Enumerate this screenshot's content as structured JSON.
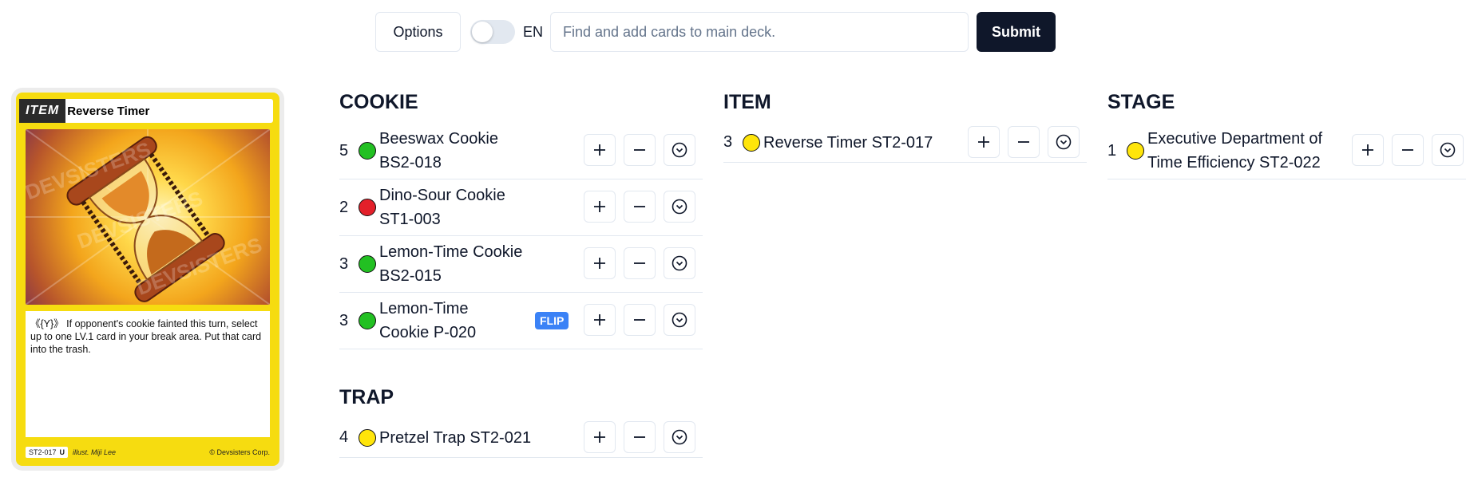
{
  "toolbar": {
    "options_label": "Options",
    "lang_label": "EN",
    "search_placeholder": "Find and add cards to main deck.",
    "search_value": "",
    "submit_label": "Submit"
  },
  "preview": {
    "type": "ITEM",
    "name": "Reverse Timer",
    "text": "《{Y}》 If opponent's cookie fainted this turn, select up to one LV.1 card in your break area. Put that card into the trash.",
    "set_code": "ST2-017",
    "rarity": "U",
    "illustrator": "illust. Miji Lee",
    "copyright": "© Devsisters Corp.",
    "watermark": "DEVSISTERS"
  },
  "sections": {
    "cookie": {
      "title": "COOKIE",
      "rows": [
        {
          "qty": "5",
          "color": "green",
          "line1": "Beeswax Cookie",
          "line2": "BS2-018"
        },
        {
          "qty": "2",
          "color": "red",
          "line1": "Dino-Sour Cookie",
          "line2": "ST1-003"
        },
        {
          "qty": "3",
          "color": "green",
          "line1": "Lemon-Time Cookie",
          "line2": "BS2-015"
        },
        {
          "qty": "3",
          "color": "green",
          "line1": "Lemon-Time",
          "line2": "Cookie P-020",
          "badge": "FLIP"
        }
      ]
    },
    "trap": {
      "title": "TRAP",
      "rows": [
        {
          "qty": "4",
          "color": "yellow",
          "line1": "Pretzel Trap ST2-021"
        }
      ]
    },
    "item": {
      "title": "ITEM",
      "rows": [
        {
          "qty": "3",
          "color": "yellow",
          "line1": "Reverse Timer ST2-017"
        }
      ]
    },
    "stage": {
      "title": "STAGE",
      "rows": [
        {
          "qty": "1",
          "color": "yellow",
          "line1": "Executive Department of",
          "line2": "Time Efficiency ST2-022"
        }
      ]
    }
  },
  "colors": {
    "green": "#22c022",
    "red": "#e3202a",
    "yellow": "#ffe50a",
    "submit_bg": "#0f172a",
    "flip_badge": "#3b82f6"
  }
}
